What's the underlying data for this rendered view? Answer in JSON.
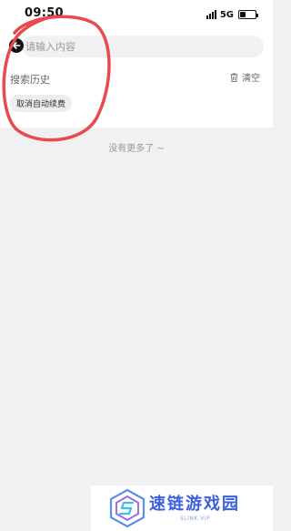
{
  "status_bar": {
    "time": "09:50",
    "network": "5G",
    "battery_level": 0.4
  },
  "search": {
    "placeholder": "请输入内容",
    "value": ""
  },
  "history": {
    "title": "搜索历史",
    "clear_label": "清空",
    "items": [
      "取消自动续费"
    ]
  },
  "results": {
    "end_text": "没有更多了 ~"
  },
  "watermark": {
    "text": "速链游戏园",
    "sub": "SLINK.VIP"
  },
  "colors": {
    "annotation": "#e84a4f",
    "background": "#f1f1f3",
    "watermark": "#3b5fe0"
  }
}
